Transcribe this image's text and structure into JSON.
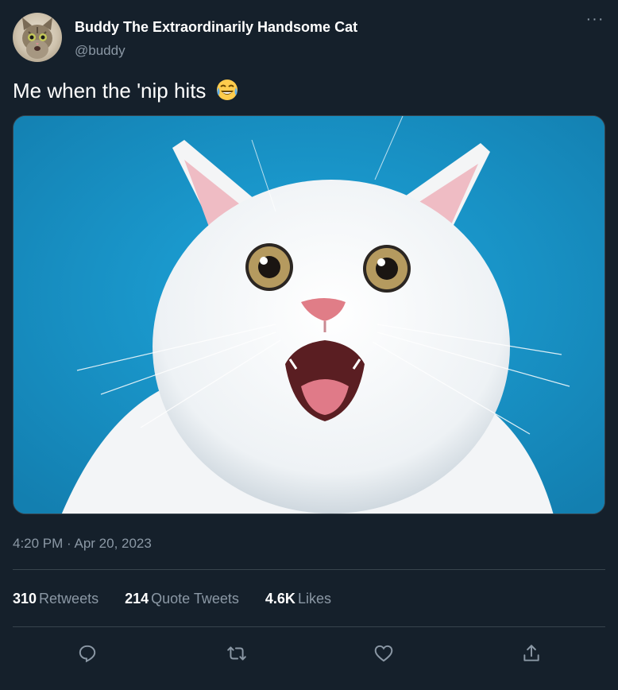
{
  "user": {
    "display_name": "Buddy The Extraordinarily Handsome Cat",
    "handle": "@buddy"
  },
  "tweet": {
    "text": "Me when the 'nip hits",
    "emoji_icon": "face-with-tears-of-joy-icon",
    "media_alt": "white cat with wide eyes and open mouth on blue background",
    "timestamp": "4:20 PM · Apr 20, 2023"
  },
  "more_menu_label": "···",
  "stats": {
    "retweets_count": "310",
    "retweets_label": "Retweets",
    "quotes_count": "214",
    "quotes_label": "Quote Tweets",
    "likes_count": "4.6K",
    "likes_label": "Likes"
  },
  "actions": [
    "reply-icon",
    "retweet-icon",
    "like-icon",
    "share-icon"
  ],
  "colors": {
    "background": "#15202b",
    "secondary_text": "#8b98a5",
    "divider": "#38444d",
    "media_background": "#1a9ad0"
  }
}
